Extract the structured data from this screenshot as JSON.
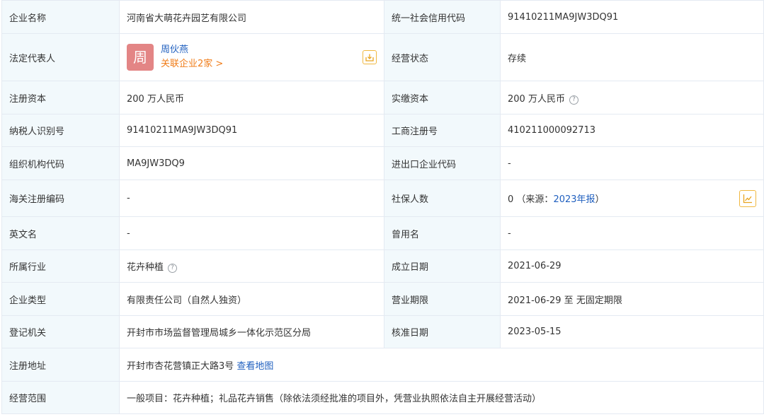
{
  "rows": {
    "company_name": {
      "label": "企业名称",
      "value": "河南省大萌花卉园艺有限公司"
    },
    "credit_code": {
      "label": "统一社会信用代码",
      "value": "91410211MA9JW3DQ91"
    },
    "legal_rep": {
      "label": "法定代表人",
      "name": "周伙燕",
      "avatar_char": "周",
      "related": "关联企业2家 >"
    },
    "status": {
      "label": "经营状态",
      "value": "存续"
    },
    "reg_capital": {
      "label": "注册资本",
      "value": "200 万人民币"
    },
    "paid_capital": {
      "label": "实缴资本",
      "value": "200 万人民币"
    },
    "taxpayer_id": {
      "label": "纳税人识别号",
      "value": "91410211MA9JW3DQ91"
    },
    "biz_reg_no": {
      "label": "工商注册号",
      "value": "410211000092713"
    },
    "org_code": {
      "label": "组织机构代码",
      "value": "MA9JW3DQ9"
    },
    "import_export": {
      "label": "进出口企业代码",
      "value": "-"
    },
    "customs_code": {
      "label": "海关注册编码",
      "value": "-"
    },
    "insured": {
      "label": "社保人数",
      "count": "0",
      "source_open": "（来源：",
      "source_link": "2023年报",
      "source_close": "）"
    },
    "english_name": {
      "label": "英文名",
      "value": "-"
    },
    "former_name": {
      "label": "曾用名",
      "value": "-"
    },
    "industry": {
      "label": "所属行业",
      "value": "花卉种植"
    },
    "founded": {
      "label": "成立日期",
      "value": "2021-06-29"
    },
    "company_type": {
      "label": "企业类型",
      "value": "有限责任公司（自然人独资）"
    },
    "term": {
      "label": "营业期限",
      "value": "2021-06-29 至 无固定期限"
    },
    "authority": {
      "label": "登记机关",
      "value": "开封市市场监督管理局城乡一体化示范区分局"
    },
    "approved": {
      "label": "核准日期",
      "value": "2023-05-15"
    },
    "address": {
      "label": "注册地址",
      "value": "开封市杏花营镇正大路3号",
      "map_link": "查看地图"
    },
    "scope": {
      "label": "经营范围",
      "value": "一般项目：花卉种植；礼品花卉销售（除依法须经批准的项目外，凭营业执照依法自主开展经营活动）"
    }
  },
  "icons": {
    "help": "?",
    "accent_border": "#f0b840"
  }
}
